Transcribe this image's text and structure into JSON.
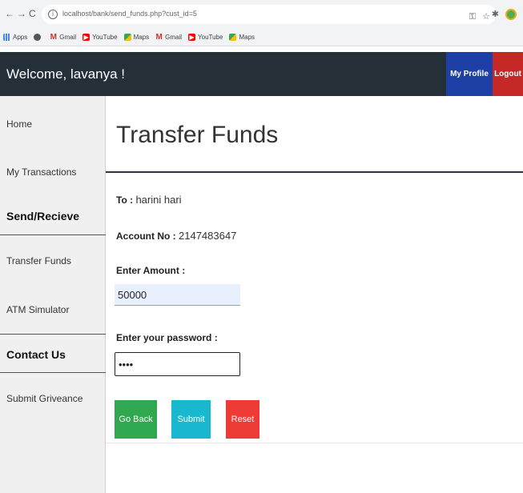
{
  "browser": {
    "back_glyph": "←",
    "forward_glyph": "→",
    "reload_glyph": "C",
    "url": "localhost/bank/send_funds.php?cust_id=5",
    "bookmarks": [
      {
        "label": "Apps",
        "icon": "apps-icon"
      },
      {
        "label": "",
        "icon": "wikipedia-icon"
      },
      {
        "label": "M",
        "icon": "gmail-icon"
      },
      {
        "label": "Gmail",
        "icon": "gmail-icon"
      },
      {
        "label": "YouTube",
        "icon": "youtube-icon"
      },
      {
        "label": "Maps",
        "icon": "maps-icon"
      },
      {
        "label": "Gmail",
        "icon": "gmail-icon"
      },
      {
        "label": "YouTube",
        "icon": "youtube-icon"
      },
      {
        "label": "Maps",
        "icon": "maps-icon"
      }
    ]
  },
  "header": {
    "welcome": "Welcome, lavanya !",
    "profile_label": "My Profile",
    "logout_label": "Logout",
    "colors": {
      "bar": "#252f38",
      "profile": "#1e40a6",
      "logout": "#c62828"
    }
  },
  "sidebar": {
    "home": "Home",
    "my_transactions": "My Transactions",
    "section_send": "Send/Recieve",
    "transfer_funds": "Transfer Funds",
    "atm_simulator": "ATM Simulator",
    "section_contact": "Contact Us",
    "submit_grievance": "Submit Griveance"
  },
  "main": {
    "title": "Transfer Funds",
    "to_label": "To :",
    "to_value": "harini hari",
    "account_label": "Account No :",
    "account_value": "2147483647",
    "amount_label": "Enter Amount :",
    "amount_value": "50000",
    "password_label": "Enter your password :",
    "password_value": "••••",
    "buttons": {
      "back": "Go Back",
      "submit": "Submit",
      "reset": "Reset"
    },
    "colors": {
      "back": "#2fa84f",
      "submit": "#19b8cf",
      "reset": "#ef3b36"
    }
  }
}
